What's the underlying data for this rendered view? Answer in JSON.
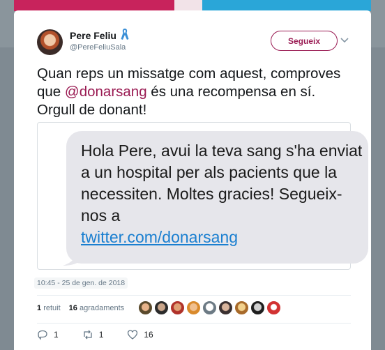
{
  "tweet": {
    "author_name": "Pere Feliu",
    "author_handle": "@PereFeliuSala",
    "follow_label": "Segueix",
    "text_before": "Quan reps un missatge com aquest, comproves que ",
    "mention": "@donarsang",
    "text_after": " és una recompensa en sí. Orgull de donant!",
    "sms_text": "Hola Pere, avui la teva sang s'ha enviat a un hospital per als pacients que la necessiten. Moltes gracies! Segueix-nos a",
    "sms_link": "twitter.com/donarsang",
    "timestamp": "10:45 - 25 de gen. de 2018",
    "retweets_count": "1",
    "retweets_label": "retuit",
    "likes_count": "16",
    "likes_label": "agradaments",
    "reply_count": "1",
    "retweet_action_count": "1",
    "like_action_count": "16"
  },
  "colors": {
    "brand": "#9a1b53",
    "link": "#1a7fd0",
    "bubble": "#e6e6eb"
  },
  "icons": {
    "ribbon": "blue-ribbon-icon",
    "caret": "chevron-down-icon",
    "reply": "reply-icon",
    "retweet": "retweet-icon",
    "like": "heart-icon"
  }
}
